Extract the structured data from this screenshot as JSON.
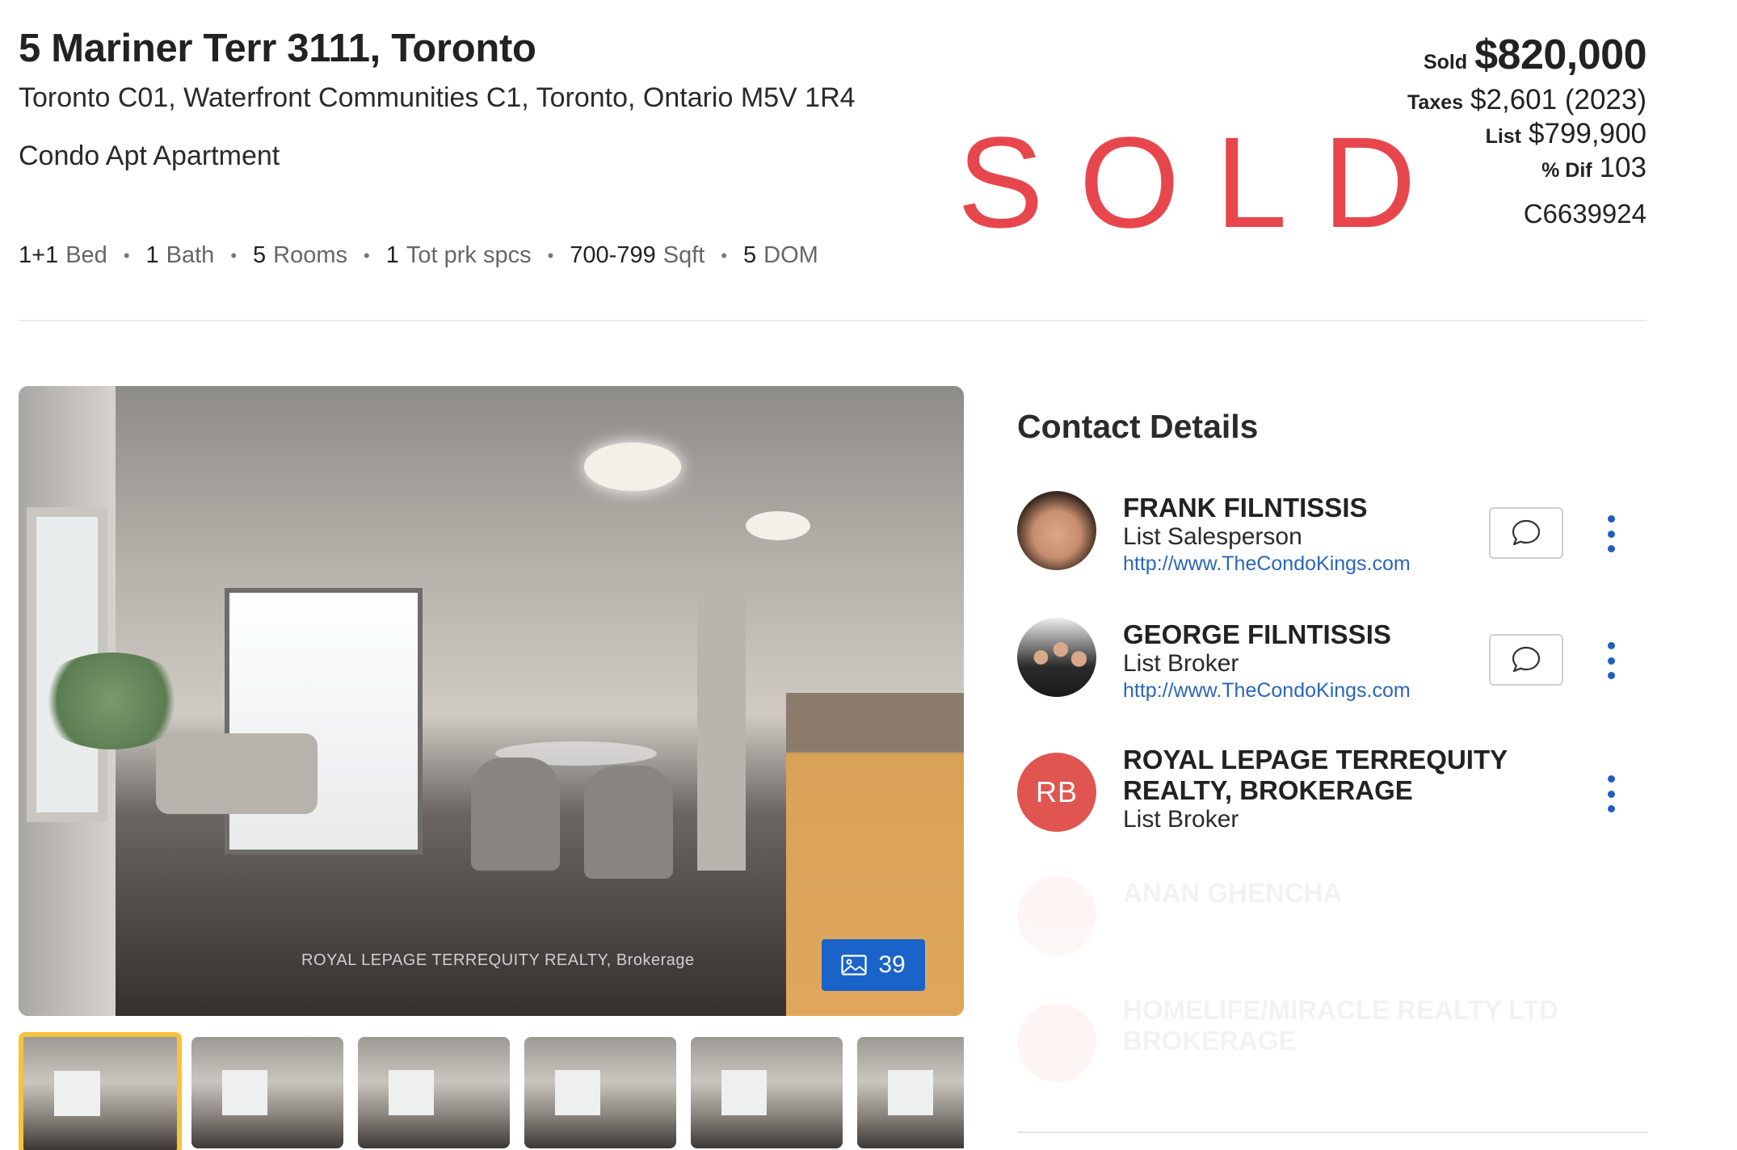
{
  "listing": {
    "title": "5 Mariner Terr 3111, Toronto",
    "address": "Toronto C01, Waterfront Communities C1, Toronto, Ontario M5V 1R4",
    "type": "Condo Apt Apartment",
    "features": [
      {
        "num": "1+1",
        "label": "Bed"
      },
      {
        "num": "1",
        "label": "Bath"
      },
      {
        "num": "5",
        "label": "Rooms"
      },
      {
        "num": "1",
        "label": "Tot prk spcs"
      },
      {
        "num": "700-799",
        "label": "Sqft"
      },
      {
        "num": "5",
        "label": "DOM"
      }
    ],
    "status_stamp": "SOLD"
  },
  "price": {
    "sold_label": "Sold",
    "sold_value": "$820,000",
    "taxes_label": "Taxes",
    "taxes_value": "$2,601 (2023)",
    "list_label": "List",
    "list_value": "$799,900",
    "dif_label": "% Dif",
    "dif_value": "103",
    "mls": "C6639924"
  },
  "gallery": {
    "watermark": "ROYAL LEPAGE TERREQUITY REALTY, Brokerage",
    "photo_count": "39",
    "thumbnails": 6
  },
  "contact": {
    "title": "Contact Details",
    "people": [
      {
        "name": "FRANK FILNTISSIS",
        "role": "List Salesperson",
        "link": "http://www.TheCondoKings.com"
      },
      {
        "name": "GEORGE FILNTISSIS",
        "role": "List Broker",
        "link": "http://www.TheCondoKings.com"
      },
      {
        "initials": "RB",
        "name_line1": "ROYAL LEPAGE TERREQUITY",
        "name_line2": "REALTY, BROKERAGE",
        "role": "List Broker"
      },
      {
        "name": "ANAN GHENCHA"
      },
      {
        "name_line1": "HOMELIFE/MIRACLE REALTY LTD",
        "name_line2": "BROKERAGE"
      }
    ]
  },
  "colors": {
    "sold_stamp": "#e8464d",
    "accent_blue": "#1a63c9",
    "link_blue": "#2a66b8",
    "initials_avatar": "#e05550",
    "active_thumb_border": "#f5c23c"
  },
  "icons": {
    "photo_count": "image-icon",
    "chat": "chat-bubble-icon",
    "more": "kebab-menu-icon"
  }
}
